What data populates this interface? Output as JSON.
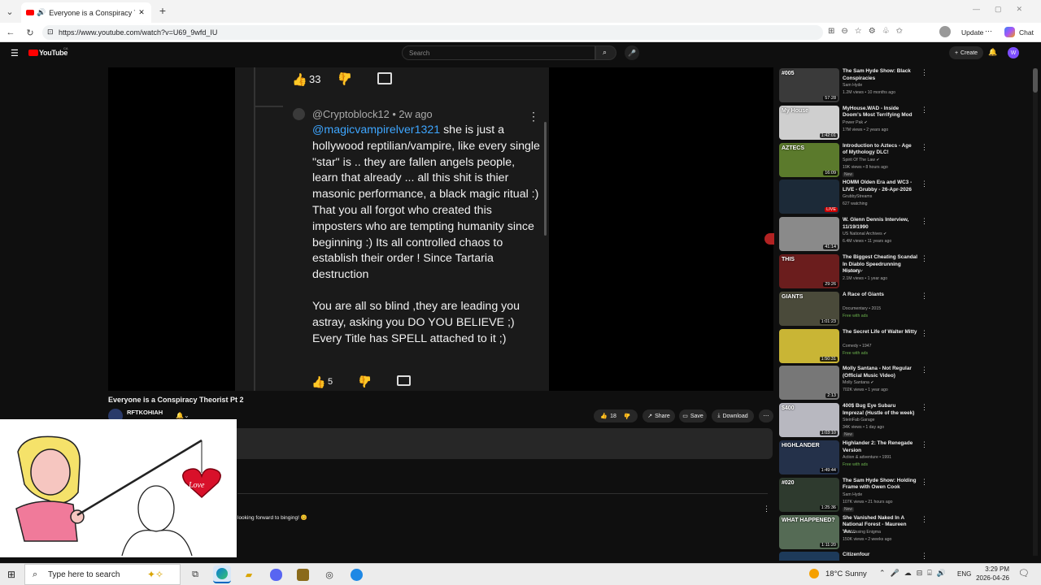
{
  "browser": {
    "tab_title": "Everyone is a Conspiracy Theo…",
    "new_tab": "+",
    "url": "https://www.youtube.com/watch?v=U69_9wfd_IU",
    "update_label": "Update",
    "chat_label": "Chat"
  },
  "youtube": {
    "logo_text": "YouTube",
    "logo_region": "CA",
    "search_placeholder": "Search",
    "create_label": "Create",
    "avatar_letter": "W"
  },
  "video_frame": {
    "top_likes": "33",
    "author": "@Cryptoblock12 • 2w ago",
    "mention": "@magicvampirelver1321",
    "comment_first": " she is just a hollywood reptilian/vampire, like every single \"star\" is .. they are fallen angels people, learn that already ... all this shit is thier masonic  performance, a black magic ritual :) That you all forgot who created this imposters who are tempting humanity since beginning :) Its all controlled chaos to establish their order ! Since Tartaria destruction",
    "comment_second": "You are all so blind ,they are leading you astray, asking you DO YOU BELIEVE ;) Every Title has SPELL attached to it ;)",
    "bottom_likes": "5"
  },
  "watch": {
    "title": "Everyone is a Conspiracy Theorist Pt 2",
    "channel": "RFTKOHIAH",
    "like_count": "18",
    "share_label": "Share",
    "save_label": "Save",
    "download_label": "Download",
    "comment_snippet": "looking forward to binging! 😊",
    "meme_caption": "Love"
  },
  "sidebar": [
    {
      "title": "The Sam Hyde Show: Black Conspiracies",
      "channel": "Sam Hyde",
      "meta": "1.2M views • 10 months ago",
      "badge": "",
      "duration": "57:28",
      "thumb_color": "#3a3a3a",
      "thumb_text": "#005"
    },
    {
      "title": "MyHouse.WAD - Inside Doom's Most Terrifying Mod",
      "channel": "Power Pak ✔",
      "meta": "17M views • 2 years ago",
      "badge": "",
      "duration": "1:42:01",
      "thumb_color": "#cfcfcf",
      "thumb_text": "My House"
    },
    {
      "title": "Introduction to Aztecs - Age of Mythology DLC!",
      "channel": "Spirit Of The Law ✔",
      "meta": "19K views • 8 hours ago",
      "badge": "New",
      "duration": "16:09",
      "thumb_color": "#5b7a2c",
      "thumb_text": "AZTECS"
    },
    {
      "title": "HOMM Olden Era and WC3 - LIVE - Grubby - 26-Apr-2026",
      "channel": "GrubbyStreams",
      "meta": "627 watching",
      "badge": "",
      "duration": "LIVE",
      "thumb_color": "#1c2a38",
      "thumb_text": ""
    },
    {
      "title": "W. Glenn Dennis Interview, 11/19/1990",
      "channel": "US National Archives ✔",
      "meta": "6.4M views • 11 years ago",
      "badge": "",
      "duration": "41:14",
      "thumb_color": "#8a8a8a",
      "thumb_text": ""
    },
    {
      "title": "The Biggest Cheating Scandal In Diablo Speedrunning History",
      "channel": "Abyssoft ✔",
      "meta": "2.1M views • 1 year ago",
      "badge": "",
      "duration": "29:26",
      "thumb_color": "#6b1d1d",
      "thumb_text": "THIS"
    },
    {
      "title": "A Race of Giants",
      "channel": "Documentary • 2015",
      "meta": "Free with ads",
      "badge": "",
      "duration": "1:01:23",
      "thumb_color": "#4a4a3a",
      "thumb_text": "GIANTS"
    },
    {
      "title": "The Secret Life of Walter Mitty",
      "channel": "Comedy • 1947",
      "meta": "Free with ads",
      "badge": "",
      "duration": "1:50:31",
      "thumb_color": "#c9b535",
      "thumb_text": ""
    },
    {
      "title": "Molly Santana - Not Regular (Official Music Video)",
      "channel": "Molly Santana ✔",
      "meta": "702K views • 1 year ago",
      "badge": "",
      "duration": "2:13",
      "thumb_color": "#777",
      "thumb_text": ""
    },
    {
      "title": "400$ Bug Eye Subaru Impreza! (Hustle of the week)",
      "channel": "SteinFab Garage",
      "meta": "34K views • 1 day ago",
      "badge": "New",
      "duration": "1:03:10",
      "thumb_color": "#b8b8c0",
      "thumb_text": "$400"
    },
    {
      "title": "Highlander 2: The Renegade Version",
      "channel": "Action & adventure • 1991",
      "meta": "Free with ads",
      "badge": "",
      "duration": "1:49:44",
      "thumb_color": "#24314a",
      "thumb_text": "HIGHLANDER"
    },
    {
      "title": "The Sam Hyde Show: Holding Frame with Owen Cook",
      "channel": "Sam Hyde",
      "meta": "107K views • 21 hours ago",
      "badge": "New",
      "duration": "1:25:36",
      "thumb_color": "#2e3a2e",
      "thumb_text": "#020"
    },
    {
      "title": "She Vanished Naked In A National Forest - Maureen 'An...",
      "channel": "The Missing Enigma",
      "meta": "150K views • 2 weeks ago",
      "badge": "",
      "duration": "1:11:20",
      "thumb_color": "#556b55",
      "thumb_text": "WHAT HAPPENED?"
    },
    {
      "title": "Citizenfour",
      "channel": "",
      "meta": "",
      "badge": "",
      "duration": "",
      "thumb_color": "#1d3a5a",
      "thumb_text": ""
    }
  ],
  "taskbar": {
    "search_placeholder": "Type here to search",
    "weather": "18°C  Sunny",
    "lang": "ENG",
    "time": "3:29 PM",
    "date": "2026-04-26"
  }
}
